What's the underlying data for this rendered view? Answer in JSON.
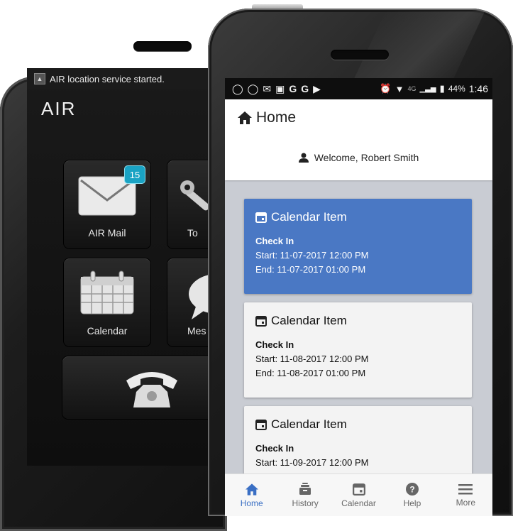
{
  "back_phone": {
    "notification": "AIR location service started.",
    "logo": "AIR",
    "tiles": [
      {
        "label": "AIR Mail",
        "badge": "15",
        "icon": "mail-icon"
      },
      {
        "label": "To",
        "icon": "tools-icon"
      },
      {
        "label": "Calendar",
        "icon": "calendar-icon"
      },
      {
        "label": "Mes",
        "icon": "message-icon"
      },
      {
        "label": "",
        "icon": "phone-icon"
      }
    ]
  },
  "status_bar": {
    "battery": "44%",
    "time": "1:46",
    "network": "4G"
  },
  "header": {
    "title": "Home",
    "welcome": "Welcome, Robert Smith"
  },
  "cards": [
    {
      "title": "Calendar Item",
      "event": "Check In",
      "start": "Start: 11-07-2017 12:00 PM",
      "end": "End: 11-07-2017 01:00 PM",
      "selected": true
    },
    {
      "title": "Calendar Item",
      "event": "Check In",
      "start": "Start: 11-08-2017 12:00 PM",
      "end": "End: 11-08-2017 01:00 PM",
      "selected": false
    },
    {
      "title": "Calendar Item",
      "event": "Check In",
      "start": "Start: 11-09-2017 12:00 PM",
      "end": "",
      "selected": false
    }
  ],
  "bottom_nav": [
    {
      "label": "Home",
      "icon": "home-icon",
      "active": true
    },
    {
      "label": "History",
      "icon": "history-icon",
      "active": false
    },
    {
      "label": "Calendar",
      "icon": "calendar-icon",
      "active": false
    },
    {
      "label": "Help",
      "icon": "help-icon",
      "active": false
    },
    {
      "label": "More",
      "icon": "menu-icon",
      "active": false
    }
  ],
  "colors": {
    "accent": "#3a6fc4",
    "selected_card": "#4a78c4",
    "badge": "#1aa3c4"
  }
}
